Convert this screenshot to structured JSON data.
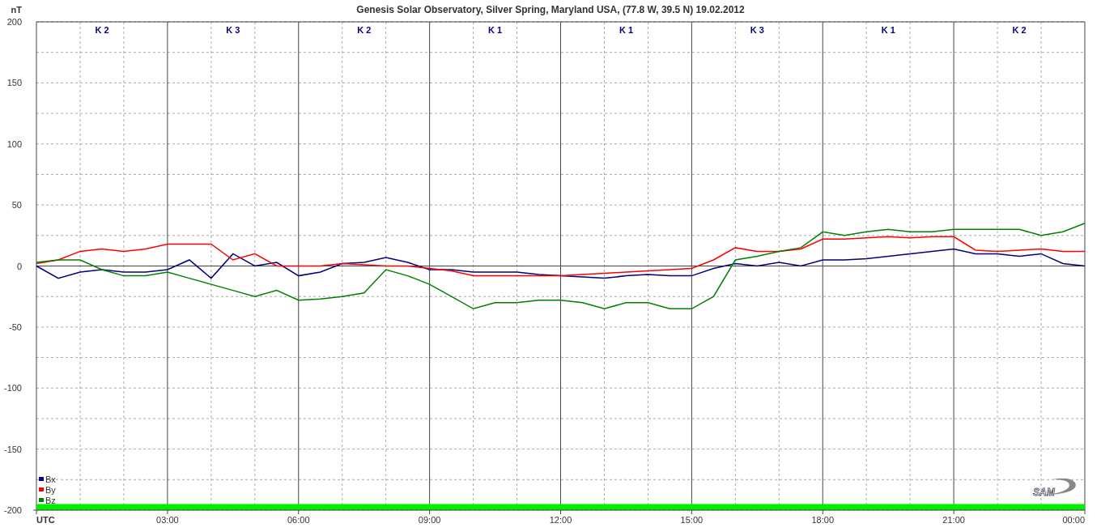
{
  "chart": {
    "k_indices": [
      "K 2",
      "K 3",
      "K 2",
      "K 1",
      "K 1",
      "K 3",
      "K 1",
      "K 2"
    ],
    "chart_data": {
      "type": "line",
      "title": "Genesis Solar Observatory, Silver Spring, Maryland USA, (77.8 W, 39.5 N)  19.02.2012",
      "ylabel": "nT",
      "x": [
        0,
        0.5,
        1,
        1.5,
        2,
        2.5,
        3,
        3.5,
        4,
        4.5,
        5,
        5.5,
        6,
        6.5,
        7,
        7.5,
        8,
        8.5,
        9,
        9.5,
        10,
        10.5,
        11,
        11.5,
        12,
        12.5,
        13,
        13.5,
        14,
        14.5,
        15,
        15.5,
        16,
        16.5,
        17,
        17.5,
        18,
        18.5,
        19,
        19.5,
        20,
        20.5,
        21,
        21.5,
        22,
        22.5,
        23,
        23.5,
        24
      ],
      "series": [
        {
          "name": "Bx",
          "color": "#000080",
          "values": [
            0,
            -10,
            -5,
            -3,
            -5,
            -5,
            -3,
            5,
            -10,
            10,
            0,
            3,
            -8,
            -5,
            2,
            3,
            7,
            3,
            -3,
            -3,
            -5,
            -5,
            -5,
            -7,
            -8,
            -9,
            -10,
            -8,
            -7,
            -8,
            -8,
            -2,
            2,
            0,
            3,
            0,
            5,
            5,
            6,
            8,
            10,
            12,
            14,
            10,
            10,
            8,
            10,
            2,
            0
          ]
        },
        {
          "name": "By",
          "color": "#ff0000",
          "values": [
            2,
            5,
            12,
            14,
            12,
            14,
            18,
            18,
            18,
            5,
            10,
            0,
            0,
            0,
            2,
            1,
            0,
            0,
            -2,
            -4,
            -8,
            -8,
            -8,
            -8,
            -8,
            -7,
            -6,
            -5,
            -4,
            -3,
            -2,
            5,
            15,
            12,
            12,
            14,
            22,
            22,
            23,
            24,
            23,
            24,
            24,
            13,
            12,
            13,
            14,
            12,
            12
          ]
        },
        {
          "name": "Bz",
          "color": "#008000",
          "values": [
            3,
            5,
            5,
            -3,
            -8,
            -8,
            -5,
            -10,
            -15,
            -20,
            -25,
            -20,
            -28,
            -27,
            -25,
            -22,
            -3,
            -8,
            -15,
            -25,
            -35,
            -30,
            -30,
            -28,
            -28,
            -30,
            -35,
            -30,
            -30,
            -35,
            -35,
            -25,
            5,
            8,
            12,
            15,
            28,
            25,
            28,
            30,
            28,
            28,
            30,
            30,
            30,
            30,
            25,
            28,
            35
          ]
        }
      ],
      "grid": true,
      "legend": "bottom-left",
      "bands": [
        {
          "axis": "y",
          "from": -200,
          "to": -195,
          "color": "#00ee00"
        }
      ],
      "xlim": [
        0,
        24
      ],
      "ylim": [
        -200,
        200
      ],
      "xticks": [
        {
          "value": 0,
          "label": "UTC"
        },
        {
          "value": 3,
          "label": "03:00"
        },
        {
          "value": 6,
          "label": "06:00"
        },
        {
          "value": 9,
          "label": "09:00"
        },
        {
          "value": 12,
          "label": "12:00"
        },
        {
          "value": 15,
          "label": "15:00"
        },
        {
          "value": 18,
          "label": "18:00"
        },
        {
          "value": 21,
          "label": "21:00"
        },
        {
          "value": 24,
          "label": "00:00"
        }
      ],
      "yticks": [
        -200,
        -150,
        -100,
        -50,
        0,
        50,
        100,
        150,
        200
      ]
    }
  },
  "logo": {
    "text": "SAM"
  }
}
